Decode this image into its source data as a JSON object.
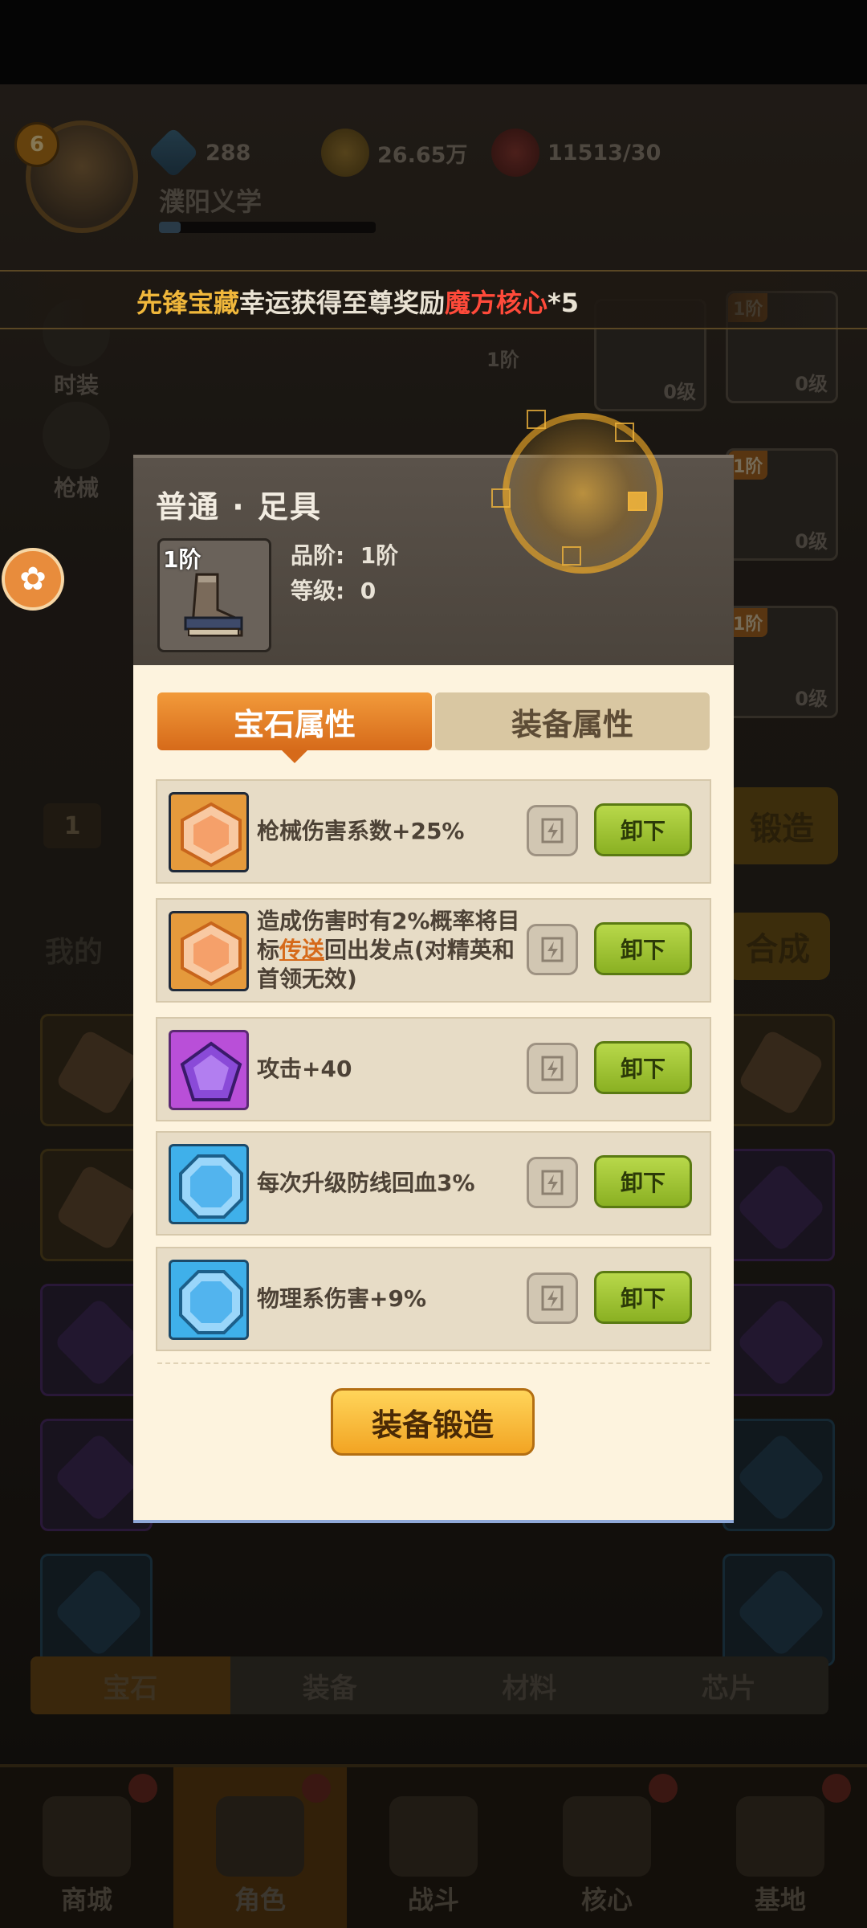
{
  "player": {
    "level": "6",
    "name": "濮阳义学",
    "xp_fraction": 0.1
  },
  "resources": {
    "gems": "288",
    "coins": "26.65万",
    "stamina": "11513/30"
  },
  "left_menu": {
    "fashion": "时装",
    "weapon": "枪械"
  },
  "broadcast": {
    "part1": "先锋宝藏",
    "part2": "幸运获得至尊奖励",
    "part3": "魔方核心",
    "part4": "*5"
  },
  "equipment_slots": {
    "mid_tier": "1阶",
    "mid_level": "0级",
    "right": [
      {
        "tier": "1阶",
        "level": "0级"
      },
      {
        "tier": "1阶",
        "level": "0级"
      },
      {
        "tier": "1阶",
        "level": "0级"
      }
    ]
  },
  "background": {
    "page_field": "1",
    "forge_button": "锻造",
    "synth_button": "合成",
    "my_label": "我的"
  },
  "gem_tabs": [
    "宝石",
    "装备",
    "材料",
    "芯片"
  ],
  "bottom_nav": [
    "商城",
    "角色",
    "战斗",
    "核心",
    "基地"
  ],
  "modal": {
    "title": "普通 · 足具",
    "item_tier": "1阶",
    "grade_label": "品阶:",
    "grade_value": "1阶",
    "level_label": "等级:",
    "level_value": "0",
    "tabs": {
      "gem_attr": "宝石属性",
      "equip_attr": "装备属性"
    },
    "gems": [
      {
        "color": "orange",
        "text": "枪械伤害系数+25%"
      },
      {
        "color": "orange",
        "text_before": "造成伤害时有2%概率将目标",
        "link": "传送",
        "text_after": "回出发点(对精英和首领无效)"
      },
      {
        "color": "purple",
        "text": "攻击+40"
      },
      {
        "color": "blue",
        "text": "每次升级防线回血3%"
      },
      {
        "color": "blue",
        "text": "物理系伤害+9%"
      }
    ],
    "unload_label": "卸下",
    "forge_label": "装备锻造"
  }
}
